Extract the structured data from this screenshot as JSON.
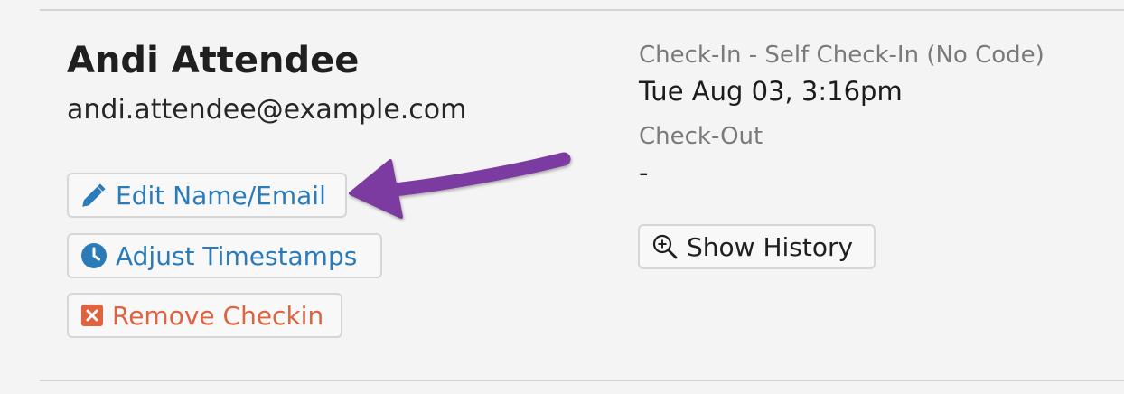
{
  "attendee": {
    "name": "Andi Attendee",
    "email": "andi.attendee@example.com"
  },
  "actions": {
    "edit_label": "Edit Name/Email",
    "adjust_label": "Adjust Timestamps",
    "remove_label": "Remove Checkin"
  },
  "checkin": {
    "label": "Check-In - Self Check-In (No Code)",
    "value": "Tue Aug 03, 3:16pm"
  },
  "checkout": {
    "label": "Check-Out",
    "value": "-"
  },
  "history": {
    "label": "Show History"
  },
  "icons": {
    "edit": "pencil-icon",
    "adjust": "clock-icon",
    "remove": "close-box-icon",
    "history": "zoom-in-icon"
  },
  "colors": {
    "link_blue": "#2b7bb9",
    "danger": "#e0623f",
    "annotation_arrow": "#7b3aa0"
  }
}
